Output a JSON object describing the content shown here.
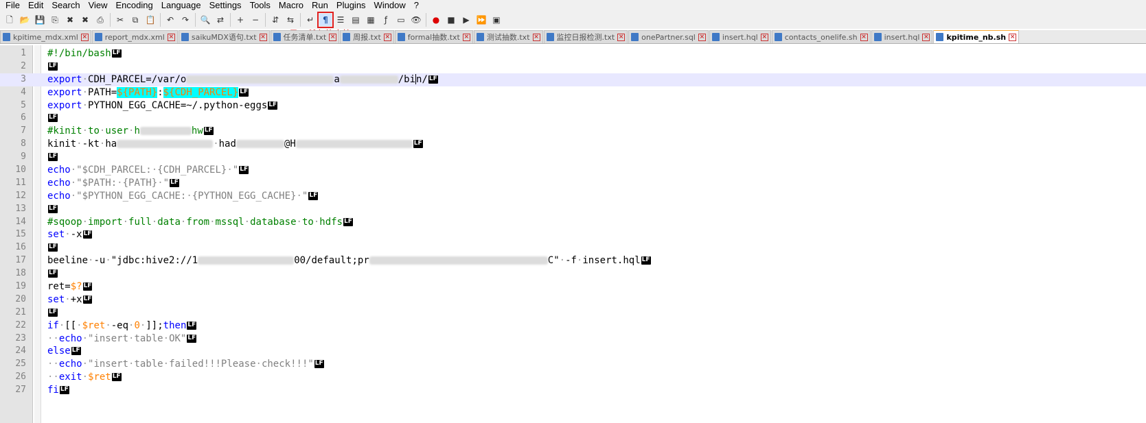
{
  "menu": [
    "File",
    "Edit",
    "Search",
    "View",
    "Encoding",
    "Language",
    "Settings",
    "Tools",
    "Macro",
    "Run",
    "Plugins",
    "Window",
    "?"
  ],
  "toolbar": {
    "icons": [
      "new-icon",
      "open-icon",
      "save-icon",
      "save-all-icon",
      "close-icon",
      "close-all-icon",
      "print-icon",
      "cut-icon",
      "copy-icon",
      "paste-icon",
      "undo-icon",
      "redo-icon",
      "find-icon",
      "replace-icon",
      "zoom-in-icon",
      "zoom-out-icon",
      "sync-v-icon",
      "sync-h-icon",
      "word-wrap-icon",
      "show-all-chars-icon",
      "indent-guide-icon",
      "udl-icon",
      "doc-map-icon",
      "function-list-icon",
      "folder-workspace-icon",
      "monitoring-icon",
      "record-macro-icon",
      "stop-macro-icon",
      "play-macro-icon",
      "run-macro-multi-icon",
      "save-macro-icon"
    ],
    "tooltip": "显示所有的字符"
  },
  "tabs": [
    {
      "label": "kpitime_mdx.xml",
      "active": false
    },
    {
      "label": "report_mdx.xml",
      "active": false
    },
    {
      "label": "saikuMDX语句.txt",
      "active": false
    },
    {
      "label": "任务清单.txt",
      "active": false
    },
    {
      "label": "周报.txt",
      "active": false
    },
    {
      "label": "formal抽数.txt",
      "active": false
    },
    {
      "label": "测试抽数.txt",
      "active": false
    },
    {
      "label": "监控日报检测.txt",
      "active": false
    },
    {
      "label": "onePartner.sql",
      "active": false
    },
    {
      "label": "insert.hql",
      "active": false
    },
    {
      "label": "contacts_onelife.sh",
      "active": false
    },
    {
      "label": "insert.hql",
      "active": false
    },
    {
      "label": "kpitime_nb.sh",
      "active": true
    }
  ],
  "eol_marker": "LF",
  "space_marker": "·",
  "colors": {
    "keyword": "#0000ff",
    "comment": "#008000",
    "string": "#808080",
    "variable": "#ff8000",
    "highlight": "#00ffff",
    "gutter": "#e4e4e4"
  },
  "lines": [
    {
      "n": "1",
      "code": [
        {
          "t": "#!/bin/bash",
          "c": "c"
        }
      ]
    },
    {
      "n": "2",
      "code": []
    },
    {
      "n": "3",
      "current": true,
      "code": [
        {
          "t": "export",
          "c": "k"
        },
        {
          "sp": 1
        },
        {
          "t": "CDH_PARCEL=/var/o"
        },
        {
          "blur": 215
        },
        {
          "t": "a"
        },
        {
          "blur": 85
        },
        {
          "t": "/bi"
        },
        {
          "caret": 1
        },
        {
          "t": "n/"
        }
      ]
    },
    {
      "n": "4",
      "code": [
        {
          "t": "export",
          "c": "k"
        },
        {
          "sp": 1
        },
        {
          "t": "PATH="
        },
        {
          "t": "${PATH}",
          "c": "v",
          "hl": 1
        },
        {
          "t": ":"
        },
        {
          "t": "${CDH_PARCEL}",
          "c": "v",
          "hl": 1
        }
      ]
    },
    {
      "n": "5",
      "code": [
        {
          "t": "export",
          "c": "k"
        },
        {
          "sp": 1
        },
        {
          "t": "PYTHON_EGG_CACHE=~/.python-eggs"
        }
      ]
    },
    {
      "n": "6",
      "code": []
    },
    {
      "n": "7",
      "code": [
        {
          "t": "#kinit",
          "c": "c"
        },
        {
          "sp": 1,
          "c": "c"
        },
        {
          "t": "to",
          "c": "c"
        },
        {
          "sp": 1,
          "c": "c"
        },
        {
          "t": "user",
          "c": "c"
        },
        {
          "sp": 1,
          "c": "c"
        },
        {
          "t": "h",
          "c": "c"
        },
        {
          "blur": 75
        },
        {
          "t": "hw",
          "c": "c"
        }
      ]
    },
    {
      "n": "8",
      "code": [
        {
          "t": "kinit"
        },
        {
          "sp": 1
        },
        {
          "t": "-kt"
        },
        {
          "sp": 1
        },
        {
          "t": "ha"
        },
        {
          "blur": 140
        },
        {
          "sp": 1
        },
        {
          "t": "had"
        },
        {
          "blur": 70
        },
        {
          "t": "@H"
        },
        {
          "blur": 170
        }
      ]
    },
    {
      "n": "9",
      "code": []
    },
    {
      "n": "10",
      "code": [
        {
          "t": "echo",
          "c": "k"
        },
        {
          "sp": 1
        },
        {
          "t": "\"$CDH_PARCEL:",
          "c": "s"
        },
        {
          "sp": 1,
          "c": "s"
        },
        {
          "t": "{CDH_PARCEL}",
          "c": "s"
        },
        {
          "sp": 1,
          "c": "s"
        },
        {
          "t": "\"",
          "c": "s"
        }
      ]
    },
    {
      "n": "11",
      "code": [
        {
          "t": "echo",
          "c": "k"
        },
        {
          "sp": 1
        },
        {
          "t": "\"$PATH:",
          "c": "s"
        },
        {
          "sp": 1,
          "c": "s"
        },
        {
          "t": "{PATH}",
          "c": "s"
        },
        {
          "sp": 1,
          "c": "s"
        },
        {
          "t": "\"",
          "c": "s"
        }
      ]
    },
    {
      "n": "12",
      "code": [
        {
          "t": "echo",
          "c": "k"
        },
        {
          "sp": 1
        },
        {
          "t": "\"$PYTHON_EGG_CACHE:",
          "c": "s"
        },
        {
          "sp": 1,
          "c": "s"
        },
        {
          "t": "{PYTHON_EGG_CACHE}",
          "c": "s"
        },
        {
          "sp": 1,
          "c": "s"
        },
        {
          "t": "\"",
          "c": "s"
        }
      ]
    },
    {
      "n": "13",
      "code": []
    },
    {
      "n": "14",
      "code": [
        {
          "t": "#sqoop",
          "c": "c"
        },
        {
          "sp": 1,
          "c": "c"
        },
        {
          "t": "import",
          "c": "c"
        },
        {
          "sp": 1,
          "c": "c"
        },
        {
          "t": "full",
          "c": "c"
        },
        {
          "sp": 1,
          "c": "c"
        },
        {
          "t": "data",
          "c": "c"
        },
        {
          "sp": 1,
          "c": "c"
        },
        {
          "t": "from",
          "c": "c"
        },
        {
          "sp": 1,
          "c": "c"
        },
        {
          "t": "mssql",
          "c": "c"
        },
        {
          "sp": 1,
          "c": "c"
        },
        {
          "t": "database",
          "c": "c"
        },
        {
          "sp": 1,
          "c": "c"
        },
        {
          "t": "to",
          "c": "c"
        },
        {
          "sp": 1,
          "c": "c"
        },
        {
          "t": "hdfs",
          "c": "c"
        }
      ]
    },
    {
      "n": "15",
      "code": [
        {
          "t": "set",
          "c": "k"
        },
        {
          "sp": 1
        },
        {
          "t": "-x"
        }
      ]
    },
    {
      "n": "16",
      "code": []
    },
    {
      "n": "17",
      "code": [
        {
          "t": "beeline"
        },
        {
          "sp": 1
        },
        {
          "t": "-u"
        },
        {
          "sp": 1
        },
        {
          "t": "\"jdbc:hive2://1"
        },
        {
          "blur": 140
        },
        {
          "t": "00/default;pr"
        },
        {
          "blur": 260
        },
        {
          "t": "C\""
        },
        {
          "sp": 1
        },
        {
          "t": "-f"
        },
        {
          "sp": 1
        },
        {
          "t": "insert.hql"
        }
      ]
    },
    {
      "n": "18",
      "code": []
    },
    {
      "n": "19",
      "code": [
        {
          "t": "ret="
        },
        {
          "t": "$?",
          "c": "v"
        }
      ]
    },
    {
      "n": "20",
      "code": [
        {
          "t": "set",
          "c": "k"
        },
        {
          "sp": 1
        },
        {
          "t": "+x"
        }
      ]
    },
    {
      "n": "21",
      "code": []
    },
    {
      "n": "22",
      "code": [
        {
          "t": "if",
          "c": "k"
        },
        {
          "sp": 1
        },
        {
          "t": "[["
        },
        {
          "sp": 1
        },
        {
          "t": "$ret",
          "c": "v"
        },
        {
          "sp": 1
        },
        {
          "t": "-eq"
        },
        {
          "sp": 1
        },
        {
          "t": "0",
          "c": "v"
        },
        {
          "sp": 1
        },
        {
          "t": "]];"
        },
        {
          "t": "then",
          "c": "k"
        }
      ]
    },
    {
      "n": "23",
      "code": [
        {
          "sp": 2
        },
        {
          "t": "echo",
          "c": "k"
        },
        {
          "sp": 1
        },
        {
          "t": "\"insert",
          "c": "s"
        },
        {
          "sp": 1,
          "c": "s"
        },
        {
          "t": "table",
          "c": "s"
        },
        {
          "sp": 1,
          "c": "s"
        },
        {
          "t": "OK\"",
          "c": "s"
        }
      ]
    },
    {
      "n": "24",
      "code": [
        {
          "t": "else",
          "c": "k"
        }
      ]
    },
    {
      "n": "25",
      "code": [
        {
          "sp": 2
        },
        {
          "t": "echo",
          "c": "k"
        },
        {
          "sp": 1
        },
        {
          "t": "\"insert",
          "c": "s"
        },
        {
          "sp": 1,
          "c": "s"
        },
        {
          "t": "table",
          "c": "s"
        },
        {
          "sp": 1,
          "c": "s"
        },
        {
          "t": "failed!!!Please",
          "c": "s"
        },
        {
          "sp": 1,
          "c": "s"
        },
        {
          "t": "check!!!\"",
          "c": "s"
        }
      ]
    },
    {
      "n": "26",
      "code": [
        {
          "sp": 2
        },
        {
          "t": "exit",
          "c": "k"
        },
        {
          "sp": 1
        },
        {
          "t": "$ret",
          "c": "v"
        }
      ]
    },
    {
      "n": "27",
      "code": [
        {
          "t": "fi",
          "c": "k"
        }
      ]
    }
  ]
}
